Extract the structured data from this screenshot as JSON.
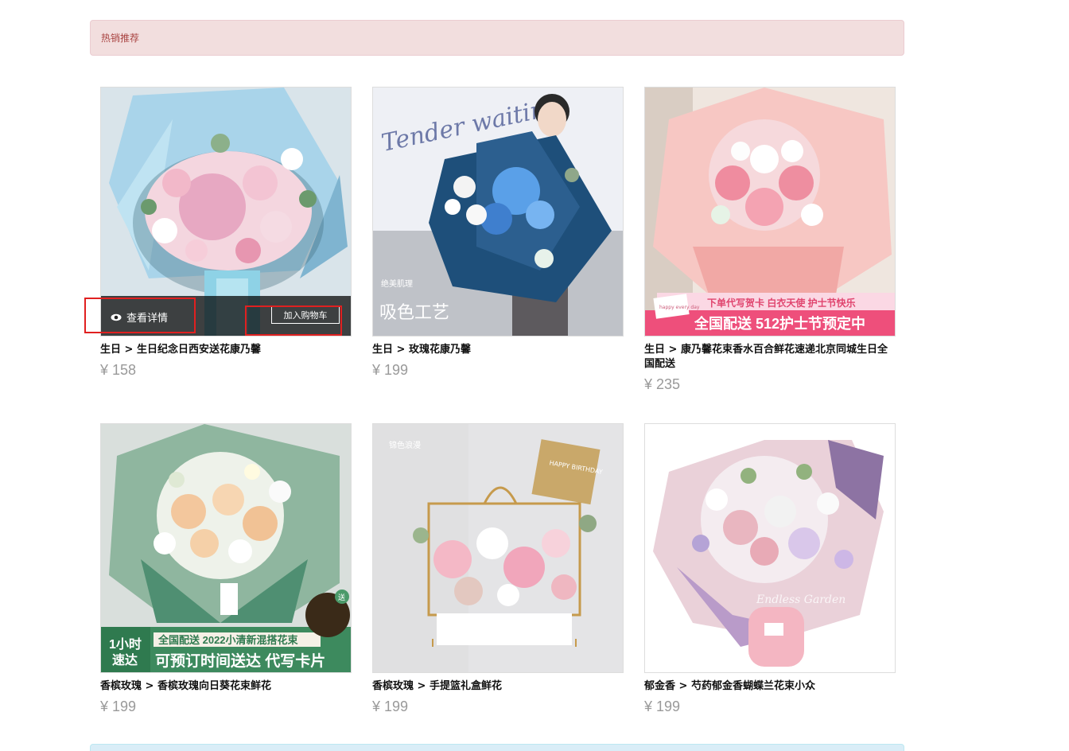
{
  "section": {
    "title": "热销推荐"
  },
  "actions": {
    "view_details": "查看详情",
    "add_to_cart": "加入购物车"
  },
  "products": [
    {
      "caption": "生日 > 生日纪念日西安送花康乃馨",
      "price": "¥ 158"
    },
    {
      "caption": "生日 > 玫瑰花康乃馨",
      "price": "¥ 199"
    },
    {
      "caption": "生日 > 康乃馨花束香水百合鲜花速递北京同城生日全国配送",
      "price": "¥ 235"
    },
    {
      "caption": "香槟玫瑰 > 香槟玫瑰向日葵花束鲜花",
      "price": "¥ 199"
    },
    {
      "caption": "香槟玫瑰 > 手提篮礼盒鲜花",
      "price": "¥ 199"
    },
    {
      "caption": "郁金香 > 芍药郁金香蝴蝶兰花束小众",
      "price": "¥ 199"
    }
  ],
  "image_text": {
    "p2_script": "Tender waiting",
    "p2_small": "绝美肌理",
    "p2_big": "吸色工艺",
    "p3_line1": "下单代写贺卡  白衣天使 护士节快乐",
    "p3_line2": "全国配送 512护士节预定中",
    "p3_card": "happy every day",
    "p4_badge_top": "1小时",
    "p4_badge_bottom": "速达",
    "p4_line1": "全国配送 2022小清新混搭花束",
    "p4_line2": "可预订时间送达 代写卡片",
    "p4_gift": "送",
    "p5_watermark": "锦色浪漫",
    "p5_card": "HAPPY BIRTHDAY",
    "p6_script": "Endless Garden"
  },
  "colors": {
    "banner_bg": "#f2dede",
    "banner_text": "#a94442",
    "highlight": "#e02020",
    "price": "#999999"
  }
}
